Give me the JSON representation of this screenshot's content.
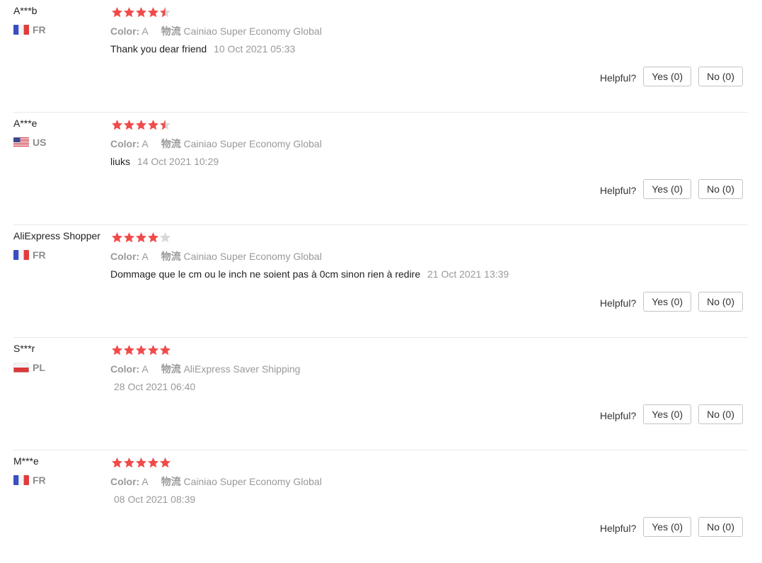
{
  "labels": {
    "color": "Color:",
    "logistics": "物流",
    "helpful": "Helpful?"
  },
  "reviews": [
    {
      "user": "A***b",
      "country": "FR",
      "flag": "fr",
      "rating": 4.5,
      "color": "A",
      "logistics": "Cainiao Super Economy Global",
      "text": "Thank you dear friend",
      "date": "10 Oct 2021 05:33",
      "yes": "Yes (0)",
      "no": "No (0)"
    },
    {
      "user": "A***e",
      "country": "US",
      "flag": "us",
      "rating": 4.5,
      "color": "A",
      "logistics": "Cainiao Super Economy Global",
      "text": "liuks",
      "date": "14 Oct 2021 10:29",
      "yes": "Yes (0)",
      "no": "No (0)"
    },
    {
      "user": "AliExpress Shopper",
      "country": "FR",
      "flag": "fr",
      "rating": 4,
      "color": "A",
      "logistics": "Cainiao Super Economy Global",
      "text": "Dommage que le cm ou le inch ne soient pas à 0cm sinon rien à redire",
      "date": "21 Oct 2021 13:39",
      "yes": "Yes (0)",
      "no": "No (0)"
    },
    {
      "user": "S***r",
      "country": "PL",
      "flag": "pl",
      "rating": 5,
      "color": "A",
      "logistics": "AliExpress Saver Shipping",
      "text": "",
      "date": "28 Oct 2021 06:40",
      "yes": "Yes (0)",
      "no": "No (0)"
    },
    {
      "user": "M***e",
      "country": "FR",
      "flag": "fr",
      "rating": 5,
      "color": "A",
      "logistics": "Cainiao Super Economy Global",
      "text": "",
      "date": "08 Oct 2021 08:39",
      "yes": "Yes (0)",
      "no": "No (0)"
    }
  ],
  "colors": {
    "star_filled": "#f04b4b",
    "star_empty": "#d8d8d8",
    "muted_text": "#999999"
  }
}
